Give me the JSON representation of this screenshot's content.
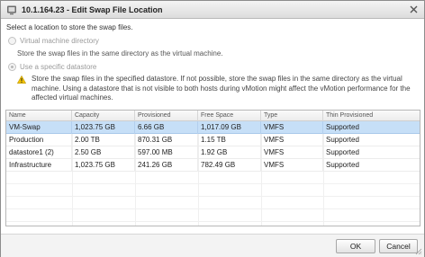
{
  "dialog": {
    "title": "10.1.164.23 - Edit Swap File Location",
    "icon": "vm-host-icon"
  },
  "prompt": "Select a location to store the swap files.",
  "options": {
    "vm_directory": {
      "label": "Virtual machine directory",
      "description": "Store the swap files in the same directory as the virtual machine.",
      "selected": false
    },
    "specific_datastore": {
      "label": "Use a specific datastore",
      "selected": true,
      "warning": "Store the swap files in the specified datastore. If not possible, store the swap files in the same directory as the virtual machine. Using a datastore that is not visible to both hosts during vMotion might affect the vMotion performance for the affected virtual machines."
    }
  },
  "table": {
    "columns": [
      "Name",
      "Capacity",
      "Provisioned",
      "Free Space",
      "Type",
      "Thin Provisioned"
    ],
    "rows": [
      {
        "name": "VM-Swap",
        "capacity": "1,023.75 GB",
        "provisioned": "6.66 GB",
        "free": "1,017.09 GB",
        "type": "VMFS",
        "thin": "Supported",
        "selected": true
      },
      {
        "name": "Production",
        "capacity": "2.00 TB",
        "provisioned": "870.31 GB",
        "free": "1.15 TB",
        "type": "VMFS",
        "thin": "Supported",
        "selected": false
      },
      {
        "name": "datastore1 (2)",
        "capacity": "2.50 GB",
        "provisioned": "597.00 MB",
        "free": "1.92 GB",
        "type": "VMFS",
        "thin": "Supported",
        "selected": false
      },
      {
        "name": "Infrastructure",
        "capacity": "1,023.75 GB",
        "provisioned": "241.26 GB",
        "free": "782.49 GB",
        "type": "VMFS",
        "thin": "Supported",
        "selected": false
      }
    ]
  },
  "buttons": {
    "ok": "OK",
    "cancel": "Cancel"
  },
  "colors": {
    "selection": "#c6dff7",
    "warning": "#f2c200"
  }
}
